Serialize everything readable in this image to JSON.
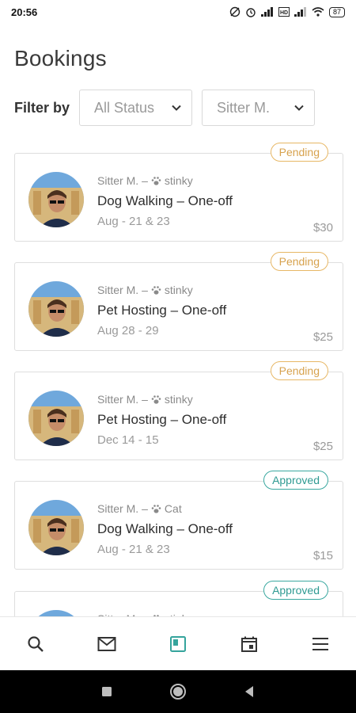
{
  "status_bar": {
    "time": "20:56",
    "battery": "87"
  },
  "page": {
    "title": "Bookings"
  },
  "filters": {
    "label": "Filter by",
    "status_value": "All Status",
    "sitter_value": "Sitter M."
  },
  "bookings": [
    {
      "sitter": "Sitter M.",
      "pet": "stinky",
      "service": "Dog Walking – One-off",
      "dates": "Aug - 21 & 23",
      "price": "$30",
      "status": "Pending"
    },
    {
      "sitter": "Sitter M.",
      "pet": "stinky",
      "service": "Pet Hosting – One-off",
      "dates": "Aug 28 - 29",
      "price": "$25",
      "status": "Pending"
    },
    {
      "sitter": "Sitter M.",
      "pet": "stinky",
      "service": "Pet Hosting – One-off",
      "dates": "Dec 14 - 15",
      "price": "$25",
      "status": "Pending"
    },
    {
      "sitter": "Sitter M.",
      "pet": "Cat",
      "service": "Dog Walking – One-off",
      "dates": "Aug - 21 & 23",
      "price": "$15",
      "status": "Approved"
    },
    {
      "sitter": "Sitter M.",
      "pet": "stinky",
      "service": "",
      "dates": "",
      "price": "",
      "status": "Approved"
    }
  ],
  "meta_separator": "–",
  "bottom_nav": {
    "items": [
      "search-icon",
      "mail-icon",
      "bookings-icon",
      "calendar-icon",
      "menu-icon"
    ],
    "active": "bookings-icon"
  },
  "colors": {
    "pending": "#e7b765",
    "approved": "#3aa8a0",
    "accent": "#35a49c"
  }
}
